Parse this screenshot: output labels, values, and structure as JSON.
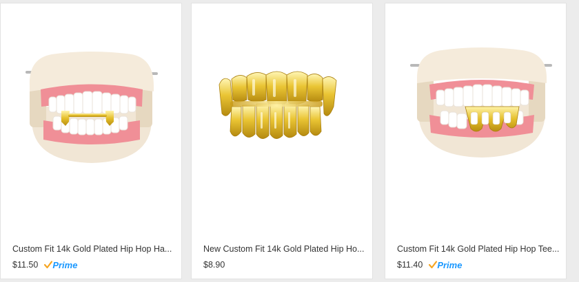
{
  "products": [
    {
      "title": "Custom Fit 14k Gold Plated Hip Hop Ha...",
      "price": "$11.50",
      "prime": "Prime",
      "image_icon": "gold-grillz-denture-model-image"
    },
    {
      "title": "New Custom Fit 14k Gold Plated Hip Ho...",
      "price": "$8.90",
      "prime": "",
      "image_icon": "gold-grillz-set-image"
    },
    {
      "title": "Custom Fit 14k Gold Plated Hip Hop Tee...",
      "price": "$11.40",
      "prime": "Prime",
      "image_icon": "gold-grillz-open-face-model-image"
    }
  ],
  "colors": {
    "prime_blue": "#1a98ff",
    "gold": "#e7c229",
    "gum_pink": "#f08f97"
  }
}
